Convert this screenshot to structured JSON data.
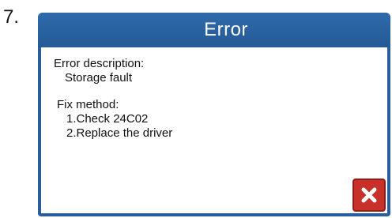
{
  "step_number": "7.",
  "dialog": {
    "title": "Error",
    "error_description_label": "Error description:",
    "error_description_value": "Storage fault",
    "fix_method_label": "Fix method:",
    "fix_steps": [
      "1.Check 24C02",
      "2.Replace the driver"
    ],
    "close_icon": "close-x-icon",
    "accent_color": "#2a5d9a",
    "close_color": "#c8302a"
  }
}
